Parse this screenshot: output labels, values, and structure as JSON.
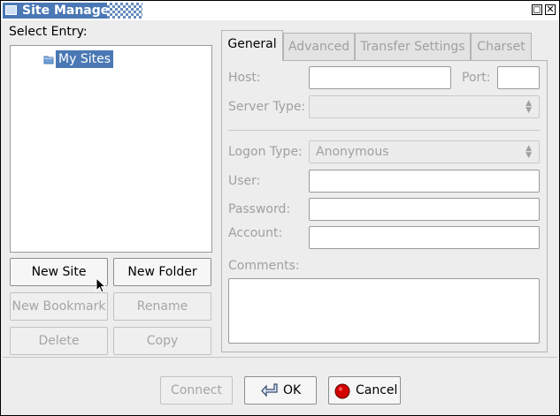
{
  "window": {
    "title": "Site Manager",
    "minimize_label": "◻",
    "close_label": "✕"
  },
  "left": {
    "select_entry_label": "Select Entry:",
    "tree": [
      {
        "label": "My Sites",
        "selected": true
      }
    ],
    "buttons": {
      "new_site": "New Site",
      "new_folder": "New Folder",
      "new_bookmark": "New Bookmark",
      "rename": "Rename",
      "delete": "Delete",
      "copy": "Copy"
    }
  },
  "tabs": [
    {
      "label": "General",
      "active": true
    },
    {
      "label": "Advanced",
      "active": false
    },
    {
      "label": "Transfer Settings",
      "active": false
    },
    {
      "label": "Charset",
      "active": false
    }
  ],
  "general": {
    "host_label": "Host:",
    "host_value": "",
    "port_label": "Port:",
    "port_value": "",
    "server_type_label": "Server Type:",
    "server_type_value": "",
    "logon_type_label": "Logon Type:",
    "logon_type_value": "Anonymous",
    "user_label": "User:",
    "user_value": "",
    "password_label": "Password:",
    "password_value": "",
    "account_label": "Account:",
    "account_value": "",
    "comments_label": "Comments:",
    "comments_value": ""
  },
  "footer": {
    "connect": "Connect",
    "ok": "OK",
    "cancel": "Cancel"
  },
  "colors": {
    "selection": "#4a78b4",
    "cancel_icon": "#d40000"
  }
}
